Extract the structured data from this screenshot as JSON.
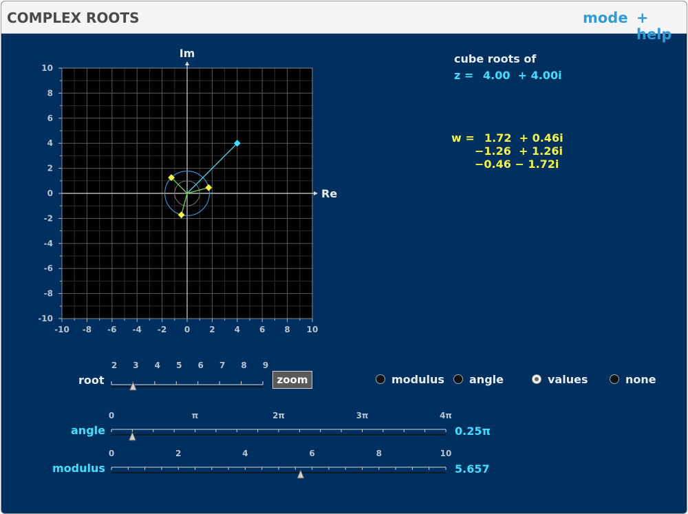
{
  "app": {
    "title": "COMPLEX ROOTS",
    "mode_link": "mode",
    "help_link": "+ help"
  },
  "plot": {
    "axis_re": "Re",
    "axis_im": "Im",
    "range": [
      -10,
      10
    ],
    "tick_labels": [
      "-10",
      "-8",
      "-6",
      "-4",
      "-2",
      "0",
      "2",
      "4",
      "6",
      "8",
      "10"
    ],
    "z_point": [
      4.0,
      4.0
    ],
    "roots": [
      [
        1.72,
        0.46
      ],
      [
        -1.26,
        1.26
      ],
      [
        -0.46,
        -1.72
      ]
    ],
    "circle_z_modulus": 1.78,
    "inner_circle": 1.0,
    "colors": {
      "z": "#3ee0ff",
      "roots": "#f5f542",
      "root_lines": "#66dd33",
      "circle": "#3a8fd0"
    }
  },
  "readout": {
    "header": "cube roots of",
    "z_label": "z =",
    "z_value": "4.00  + 4.00i",
    "w_label": "w =",
    "w1": "1.72  + 0.46i",
    "w2": "−1.26  + 1.26i",
    "w3": "−0.46 − 1.72i"
  },
  "root_slider": {
    "label": "root",
    "ticks": [
      "2",
      "3",
      "4",
      "5",
      "6",
      "7",
      "8",
      "9"
    ],
    "value": 3
  },
  "zoom_button": {
    "label": "zoom"
  },
  "display_options": [
    {
      "label": "modulus",
      "checked": false
    },
    {
      "label": "angle",
      "checked": false
    },
    {
      "label": "values",
      "checked": true
    },
    {
      "label": "none",
      "checked": false
    }
  ],
  "angle_slider": {
    "label": "angle",
    "ticks": [
      "0",
      "π",
      "2π",
      "3π",
      "4π"
    ],
    "value": 0.25,
    "value_text": "0.25π"
  },
  "modulus_slider": {
    "label": "modulus",
    "ticks": [
      "0",
      "2",
      "4",
      "6",
      "8",
      "10"
    ],
    "value": 5.657,
    "value_text": "5.657"
  }
}
